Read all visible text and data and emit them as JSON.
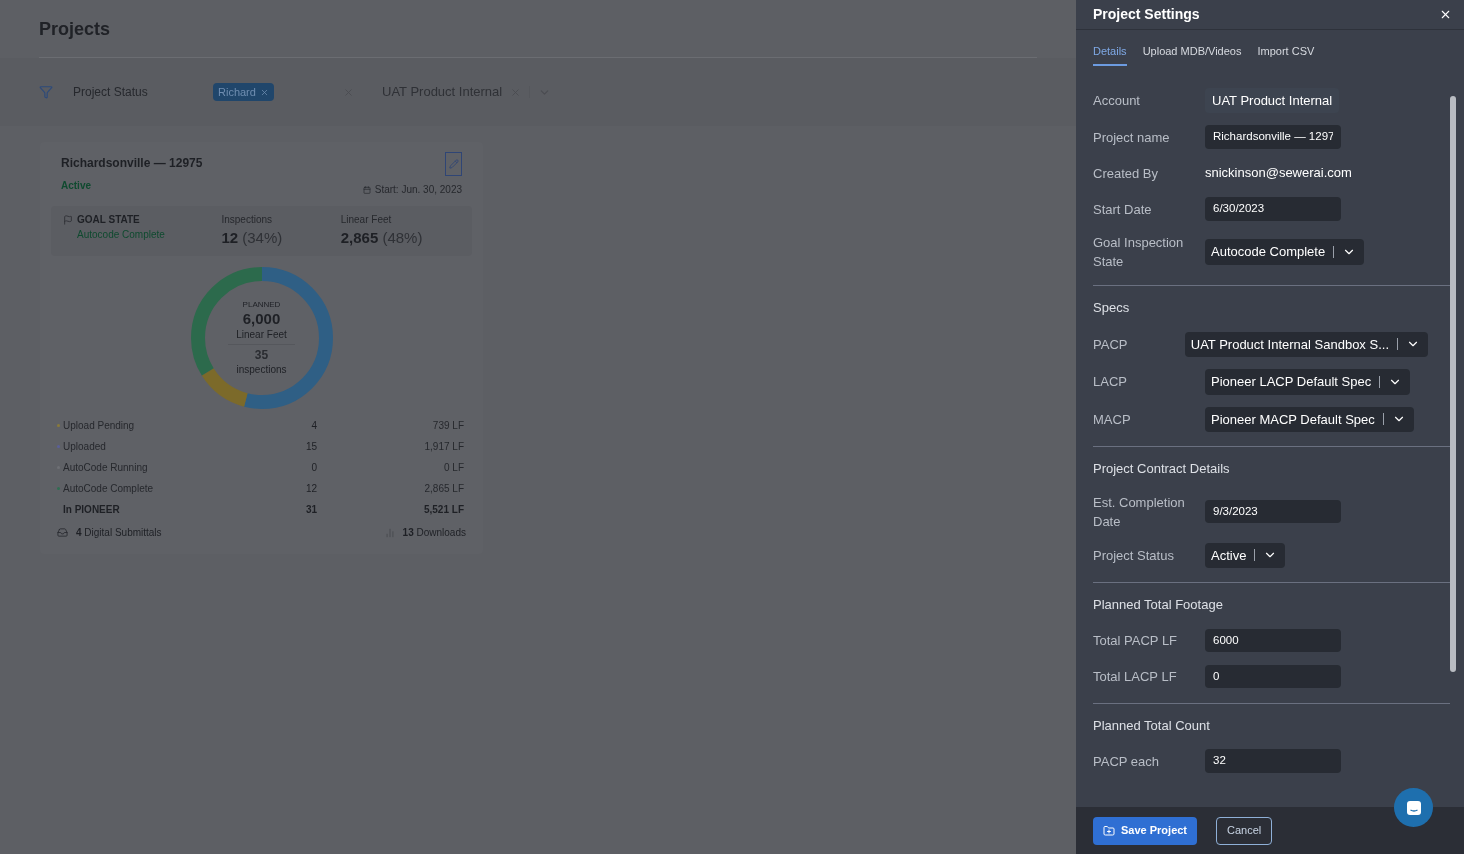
{
  "page": {
    "title": "Projects"
  },
  "filters": {
    "status": {
      "placeholder": "Project Status",
      "tags": [
        "Richard"
      ]
    },
    "account": {
      "value": "UAT Product Internal"
    }
  },
  "project_card": {
    "title": "Richardsonville — 12975",
    "status": "Active",
    "start": "Start: Jun. 30, 2023",
    "goal": {
      "label": "GOAL STATE",
      "value": "Autocode Complete"
    },
    "stats": [
      {
        "label": "Inspections",
        "value": "12",
        "percent": "(34%)"
      },
      {
        "label": "Linear Feet",
        "value": "2,865",
        "percent": "(48%)"
      }
    ],
    "donut": {
      "caption": "PLANNED",
      "footage": "6,000",
      "footage_unit": "Linear Feet",
      "count": "35",
      "count_unit": "inspections"
    },
    "rows": [
      {
        "kind": "state",
        "label": "Upload Pending",
        "count": "4",
        "footage": "739 LF",
        "color": "#8a7a3a"
      },
      {
        "kind": "state",
        "label": "Uploaded",
        "count": "15",
        "footage": "1,917 LF",
        "color": "#5a5f9a"
      },
      {
        "kind": "state",
        "label": "AutoCode Running",
        "count": "0",
        "footage": "0 LF",
        "color": "#6e7075"
      },
      {
        "kind": "state",
        "label": "AutoCode Complete",
        "count": "12",
        "footage": "2,865 LF",
        "color": "#2f6e52"
      },
      {
        "kind": "total",
        "label": "In PIONEER",
        "count": "31",
        "footage": "5,521 LF"
      }
    ],
    "footer": {
      "submittals": "**4** Digital Submittals",
      "downloads": "**13** Downloads"
    }
  },
  "drawer": {
    "title": "Project Settings",
    "tabs": [
      {
        "label": "Details",
        "selected": true
      },
      {
        "label": "Upload MDB/Videos",
        "selected": false
      },
      {
        "label": "Import CSV",
        "selected": false
      }
    ],
    "sections": [
      {
        "fields": [
          {
            "kind": "readonly",
            "label": "Account",
            "value": "UAT Product Internal"
          },
          {
            "kind": "input",
            "label": "Project name",
            "value": "Richardsonville — 1297"
          },
          {
            "kind": "text",
            "label": "Created By",
            "value": "snickinson@sewerai.com"
          },
          {
            "kind": "input",
            "label": "Start Date",
            "value": "6/30/2023"
          },
          {
            "kind": "select",
            "label": "Goal Inspection State",
            "value": "Autocode Complete"
          }
        ]
      },
      {
        "title": "Specs",
        "fields": [
          {
            "kind": "select",
            "label": "PACP",
            "value": "UAT Product Internal Sandbox S..."
          },
          {
            "kind": "select",
            "label": "LACP",
            "value": "Pioneer LACP Default Spec"
          },
          {
            "kind": "select",
            "label": "MACP",
            "value": "Pioneer MACP Default Spec"
          }
        ]
      },
      {
        "title": "Project Contract Details",
        "fields": [
          {
            "kind": "input",
            "label": "Est. Completion Date",
            "value": "9/3/2023"
          },
          {
            "kind": "select",
            "label": "Project Status",
            "value": "Active"
          }
        ]
      },
      {
        "title": "Planned Total Footage",
        "fields": [
          {
            "kind": "input",
            "label": "Total PACP LF",
            "value": "6000"
          },
          {
            "kind": "input",
            "label": "Total LACP LF",
            "value": "0"
          }
        ]
      },
      {
        "title": "Planned Total Count",
        "fields": [
          {
            "kind": "input",
            "label": "PACP each",
            "value": "32"
          }
        ]
      }
    ],
    "buttons": {
      "save": "Save Project",
      "cancel": "Cancel"
    }
  }
}
